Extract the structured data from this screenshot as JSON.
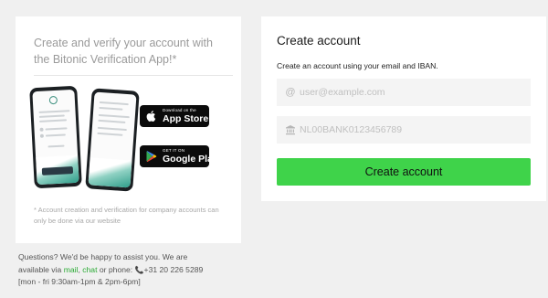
{
  "left_card": {
    "title": "Create and verify your account with the Bitonic Verification App!*",
    "app_store": {
      "small": "Download on the",
      "big": "App Store",
      "icon": "apple-icon"
    },
    "google_play": {
      "small": "GET IT ON",
      "big": "Google Play",
      "icon": "google-play-icon"
    },
    "note": "* Account creation and verification for company accounts can only be done via our website"
  },
  "help": {
    "line1": "Questions? We'd be happy to assist you. We are",
    "available_via": "available via ",
    "mail_link": "mail",
    "comma": ", ",
    "chat_link": "chat",
    "or_phone": " or phone: ",
    "phone_icon": "phone-icon",
    "phone_number": "+31 20 226 5289",
    "hours": "[mon - fri 9:30am-1pm & 2pm-6pm]"
  },
  "right_card": {
    "title": "Create account",
    "subtitle": "Create an account using your email and IBAN.",
    "email": {
      "placeholder": "user@example.com",
      "value": "",
      "icon": "at-icon"
    },
    "iban": {
      "placeholder": "NL00BANK0123456789",
      "value": "",
      "icon": "bank-icon"
    },
    "create_button": "Create account"
  },
  "colors": {
    "background": "#f0f0f0",
    "accent_green": "#3fd34a",
    "link_green": "#2aaa34",
    "field_bg": "#f4f4f4"
  }
}
